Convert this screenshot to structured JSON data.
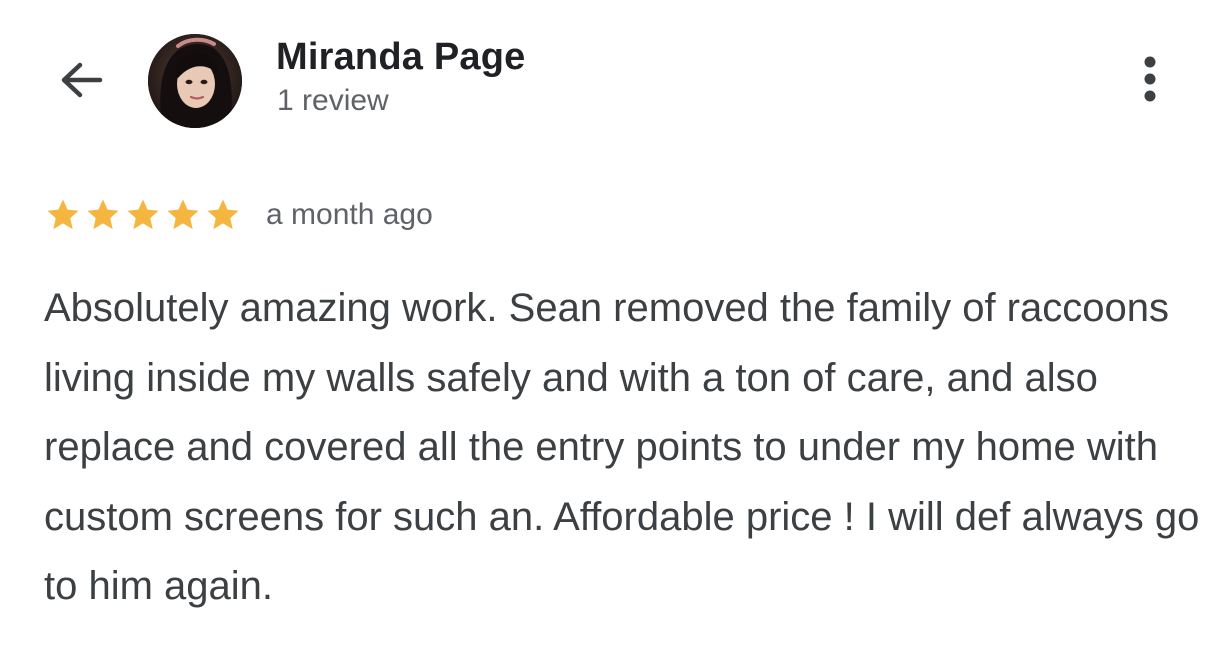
{
  "header": {
    "back_icon": "arrow-left-icon",
    "reviewer_name": "Miranda Page",
    "review_count": "1 review",
    "menu_icon": "more-vertical-icon"
  },
  "review": {
    "rating": 5,
    "rating_max": 5,
    "star_color": "#F4B63F",
    "date": "a month ago",
    "text": "Absolutely amazing work. Sean removed the family of raccoons living inside my walls safely and with a ton of care, and also replace and covered all the entry points to under my home with custom screens for such an. Affordable price ! I will def always go to him again."
  },
  "colors": {
    "name_text": "#202124",
    "secondary_text": "#5f6368",
    "body_text": "#3c4043",
    "background": "#ffffff"
  }
}
